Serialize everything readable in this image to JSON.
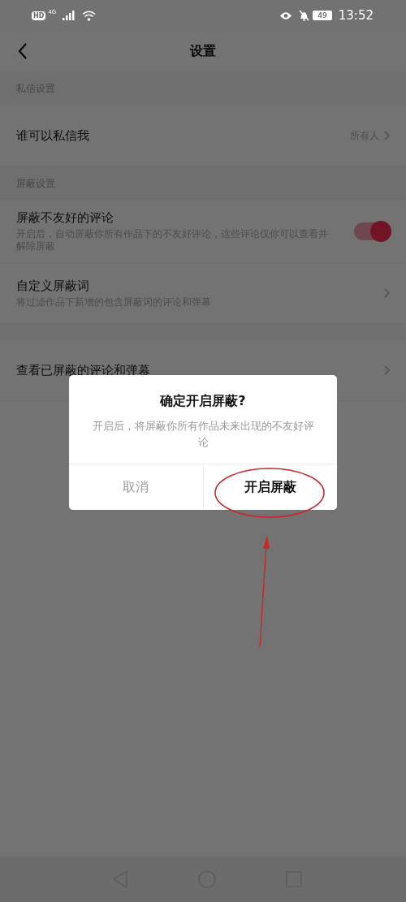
{
  "status_bar": {
    "badge": "HD",
    "network": "4G",
    "battery": "49",
    "time": "13:52"
  },
  "header": {
    "title": "设置"
  },
  "sections": [
    {
      "title": "私信设置",
      "items": [
        {
          "kind": "link",
          "label": "谁可以私信我",
          "value": "所有人"
        }
      ]
    },
    {
      "title": "屏蔽设置",
      "items": [
        {
          "kind": "toggle",
          "label": "屏蔽不友好的评论",
          "description": "开启后，自动屏蔽你所有作品下的不友好评论，这些评论仅你可以查看并解除屏蔽",
          "on": true
        },
        {
          "kind": "link",
          "label": "自定义屏蔽词",
          "description": "将过滤作品下新增的包含屏蔽词的评论和弹幕"
        }
      ]
    },
    {
      "items": [
        {
          "kind": "link",
          "label": "查看已屏蔽的评论和弹幕"
        }
      ]
    }
  ],
  "dialog": {
    "title": "确定开启屏蔽?",
    "message": "开启后，将屏蔽你所有作品未来出现的不友好评论",
    "buttons": [
      {
        "label": "取消",
        "primary": false
      },
      {
        "label": "开启屏蔽",
        "primary": true
      }
    ]
  }
}
